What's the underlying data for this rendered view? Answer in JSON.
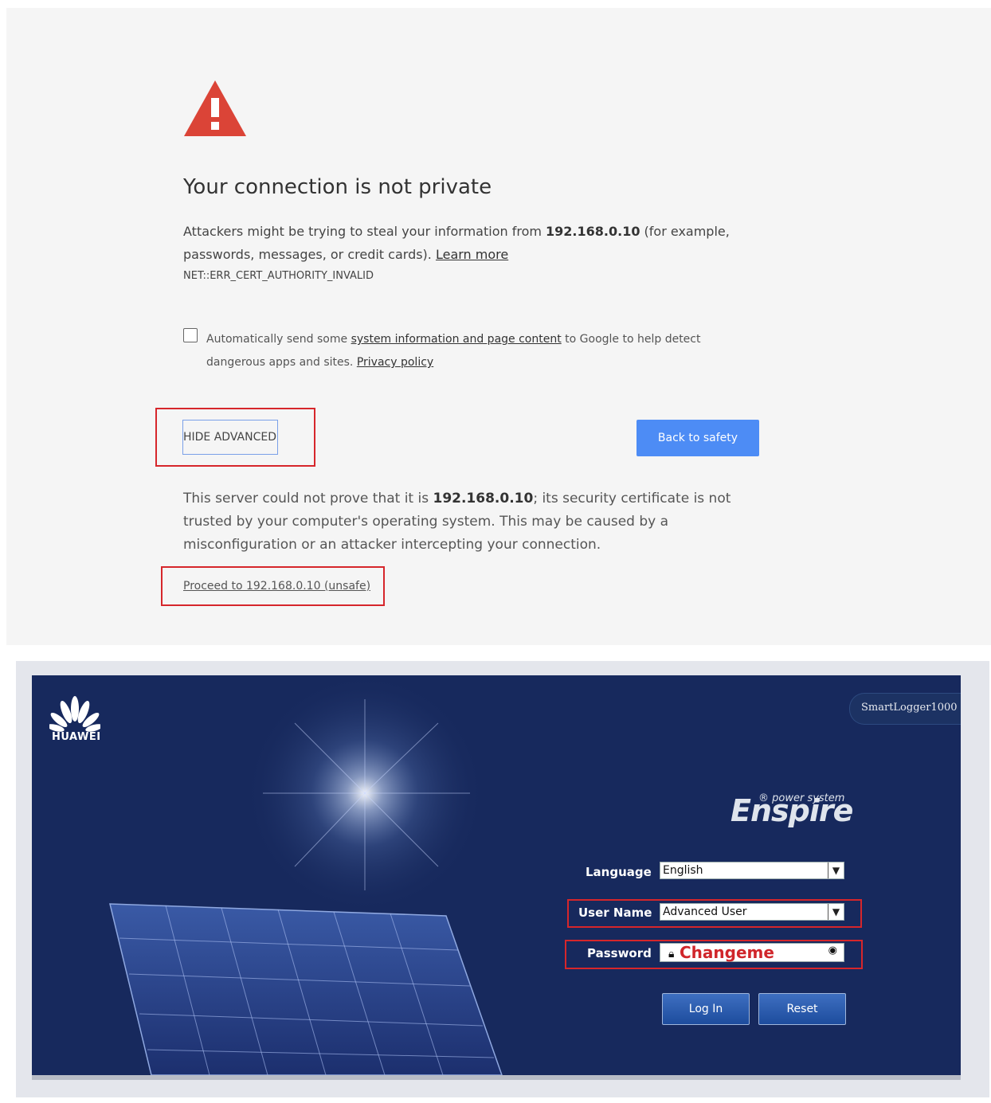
{
  "privacy_error": {
    "title": "Your connection is not private",
    "desc_prefix": "Attackers might be trying to steal your information from ",
    "desc_host": "192.168.0.10",
    "desc_suffix": " (for example, passwords, messages, or credit cards). ",
    "learn_more": "Learn more",
    "error_code": "NET::ERR_CERT_AUTHORITY_INVALID",
    "checkbox_checked": false,
    "checkbox_prefix": "Automatically send some ",
    "checkbox_link": "system information and page content",
    "checkbox_middle": " to Google to help detect dangerous apps and sites. ",
    "privacy_policy": "Privacy policy",
    "hide_advanced_label": "HIDE ADVANCED",
    "back_to_safety_label": "Back to safety",
    "explain_prefix": "This server could not prove that it is ",
    "explain_host": "192.168.0.10",
    "explain_suffix": "; its security certificate is not trusted by your computer's operating system. This may be caused by a misconfiguration or an attacker intercepting your connection.",
    "proceed_link": "Proceed to 192.168.0.10 (unsafe)"
  },
  "login": {
    "brand_logo_text": "HUAWEI",
    "model": "SmartLogger1000",
    "product_brand": "Enspire",
    "product_tagline": "® power system",
    "fields": {
      "language_label": "Language",
      "language_value": "English",
      "username_label": "User Name",
      "username_value": "Advanced User",
      "password_label": "Password",
      "password_value": "Changeme"
    },
    "login_button": "Log In",
    "reset_button": "Reset"
  },
  "colors": {
    "warning_red": "#db4437",
    "chrome_blue": "#4d8cf5",
    "login_background": "#17295d",
    "highlight_box": "#d6262b"
  },
  "icons": [
    "warning-triangle-icon",
    "checkbox-icon",
    "huawei-logo-icon",
    "chevron-down-icon",
    "lock-icon",
    "eye-icon"
  ]
}
